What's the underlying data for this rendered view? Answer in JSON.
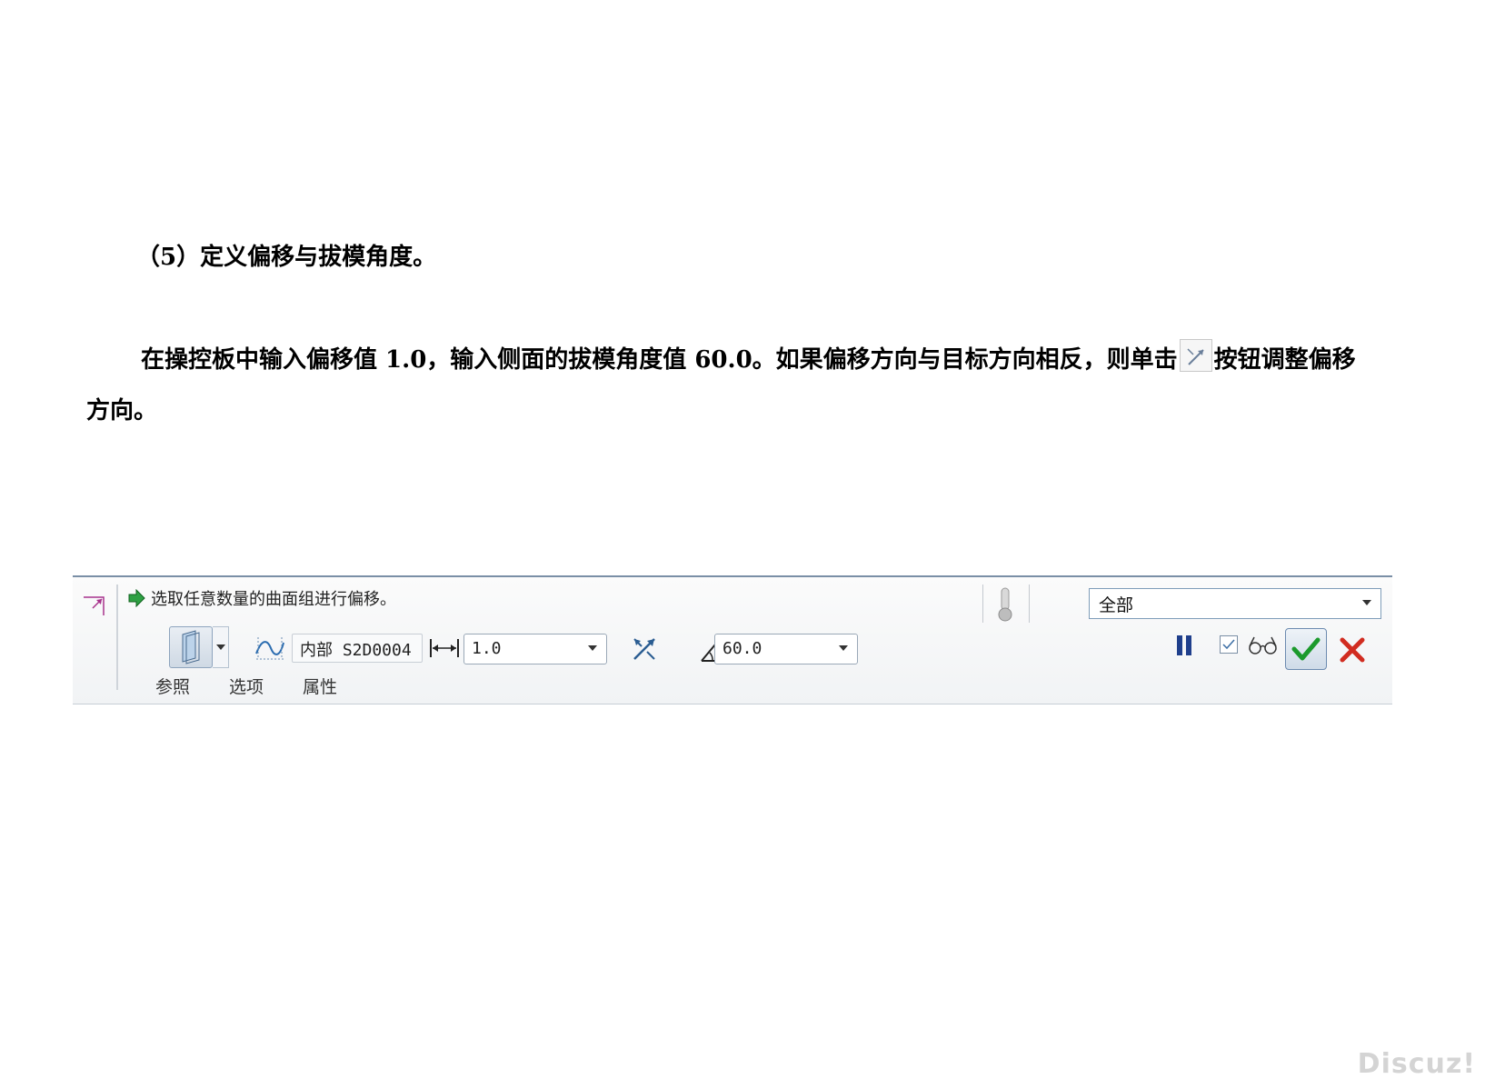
{
  "document": {
    "heading": "（5）定义偏移与拔模角度。",
    "para_before_icon": "在操控板中输入偏移值 1.0，输入侧面的拔模角度值 60.0。如果偏移方向与目标方向相反，则单击",
    "para_after_icon": "按钮调整偏移方向。",
    "inline_icon": "flip-direction-icon"
  },
  "toolbar": {
    "message": "选取任意数量的曲面组进行偏移。",
    "filter_value": "全部",
    "reference_label": "内部 S2D0004",
    "offset_value": "1.0",
    "angle_value": "60.0",
    "tabs": [
      "参照",
      "选项",
      "属性"
    ]
  },
  "watermark": "Discuz!"
}
